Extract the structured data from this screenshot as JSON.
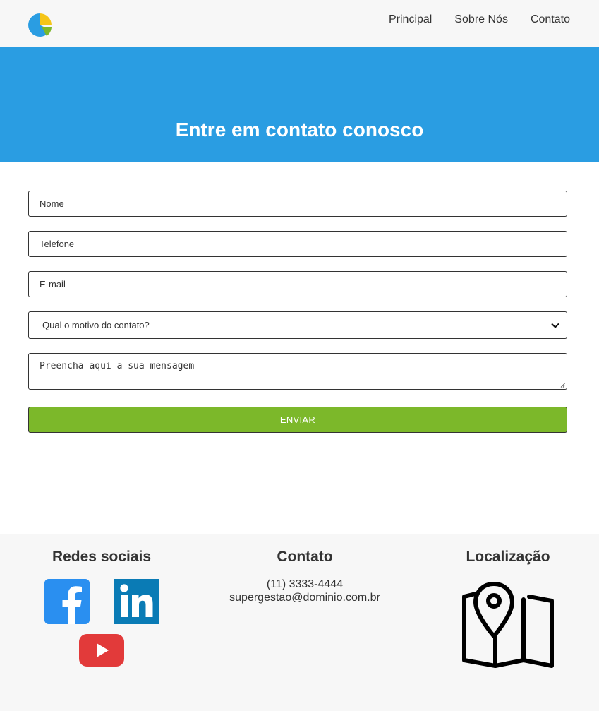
{
  "header": {
    "logo_icon": "pie-chart-logo-icon",
    "nav": [
      "Principal",
      "Sobre Nós",
      "Contato"
    ]
  },
  "hero": {
    "title": "Entre em contato conosco",
    "background": "#2a9de2"
  },
  "form": {
    "name_placeholder": "Nome",
    "phone_placeholder": "Telefone",
    "email_placeholder": "E-mail",
    "reason_selected": "Qual o motivo do contato?",
    "message_placeholder": "Preencha aqui a sua mensagem",
    "submit_label": "ENVIAR",
    "submit_color": "#7cb82a"
  },
  "footer": {
    "social_title": "Redes sociais",
    "social_icons": [
      "facebook-icon",
      "linkedin-icon",
      "youtube-icon"
    ],
    "contact_title": "Contato",
    "phone": "(11) 3333-4444",
    "email": "supergestao@dominio.com.br",
    "location_title": "Localização",
    "location_icon": "map-pin-icon"
  }
}
